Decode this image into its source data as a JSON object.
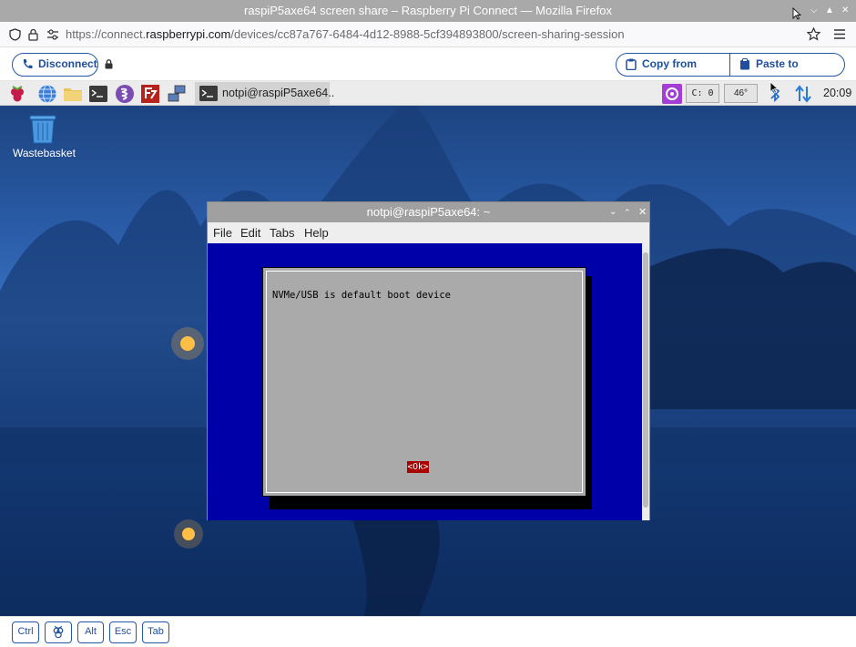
{
  "browser": {
    "window_title": "raspiP5axe64 screen share – Raspberry Pi Connect — Mozilla Firefox",
    "url_prefix": "https://connect.",
    "url_domain": "raspberrypi.com",
    "url_path": "/devices/cc87a767-6484-4d12-8988-5cf394893800/screen-sharing-session"
  },
  "connect": {
    "disconnect_label": "Disconnect",
    "copy_label": "Copy from remote",
    "paste_label": "Paste to remote"
  },
  "taskbar": {
    "active_window_label": "notpi@raspiP5axe64..",
    "cpu_label": "C:  0",
    "temp_label": "46°",
    "clock": "20:09"
  },
  "desktop": {
    "wastebasket_label": "Wastebasket"
  },
  "terminal": {
    "title": "notpi@raspiP5axe64: ~",
    "menu": [
      "File",
      "Edit",
      "Tabs",
      "Help"
    ],
    "dialog_message": "NVMe/USB is default boot device",
    "ok_label": "<Ok>"
  },
  "keys": [
    "Ctrl",
    "",
    "Alt",
    "Esc",
    "Tab"
  ],
  "colors": {
    "accent": "#2457a8",
    "terminal_bg": "#0000aa",
    "dialog_bg": "#aaaaaa",
    "ok_button": "#aa0000"
  }
}
